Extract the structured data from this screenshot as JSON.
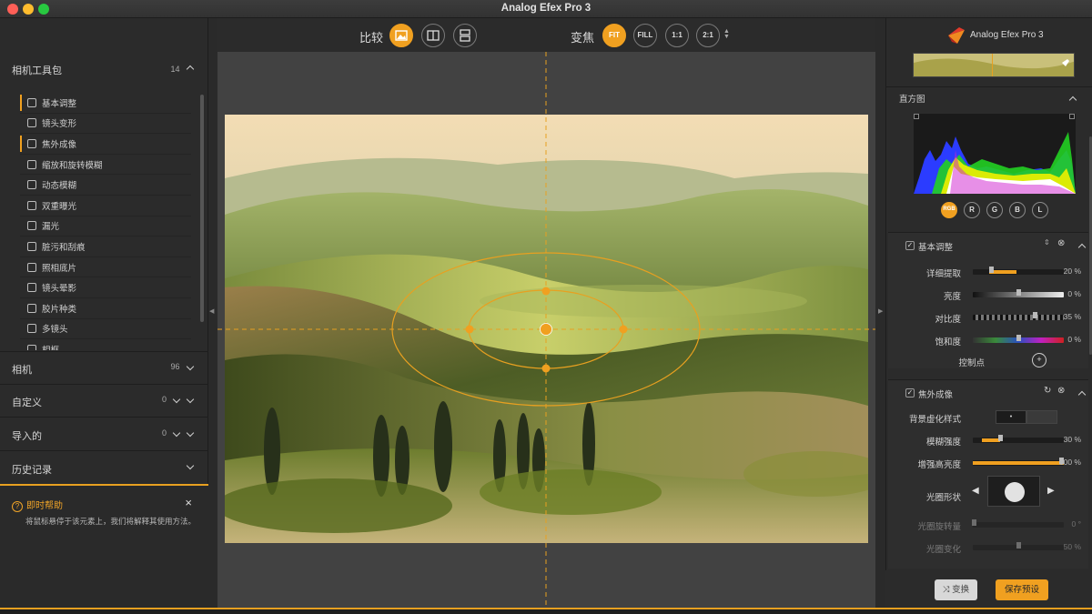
{
  "window": {
    "title": "Analog Efex Pro 3"
  },
  "left_panel": {
    "toolkit": {
      "title": "相机工具包",
      "count": "14"
    },
    "tools": [
      {
        "label": "基本调整",
        "active": true
      },
      {
        "label": "镜头变形",
        "active": false
      },
      {
        "label": "焦外成像",
        "active": true
      },
      {
        "label": "缩放和旋转模糊",
        "active": false
      },
      {
        "label": "动态模糊",
        "active": false
      },
      {
        "label": "双重曝光",
        "active": false
      },
      {
        "label": "漏光",
        "active": false
      },
      {
        "label": "脏污和刮痕",
        "active": false
      },
      {
        "label": "照相底片",
        "active": false
      },
      {
        "label": "镜头晕影",
        "active": false
      },
      {
        "label": "胶片种类",
        "active": false
      },
      {
        "label": "多镜头",
        "active": false
      },
      {
        "label": "相框",
        "active": false
      }
    ],
    "sections": [
      {
        "title": "相机",
        "count": "96"
      },
      {
        "title": "自定义",
        "count": "0"
      },
      {
        "title": "导入的",
        "count": "0"
      },
      {
        "title": "历史记录",
        "count": ""
      }
    ],
    "help": {
      "title": "即时帮助",
      "text": "将鼠标悬停于该元素上，我们将解释其使用方法。"
    }
  },
  "toolbar": {
    "compare_label": "比较",
    "zoom_label": "变焦",
    "zoom_options": [
      "FIT",
      "FILL",
      "1:1",
      "2:1"
    ],
    "zoom_selected": "FIT"
  },
  "right_panel": {
    "logo_text": "Analog Efex Pro 3",
    "histogram": {
      "title": "直方图",
      "channels": [
        "RGB",
        "R",
        "G",
        "B",
        "L"
      ],
      "selected": "RGB"
    },
    "basic": {
      "title": "基本调整",
      "rows": [
        {
          "label": "详细提取",
          "value": "20 %",
          "level": 0.2
        },
        {
          "label": "亮度",
          "value": "0 %",
          "level": 0.5
        },
        {
          "label": "对比度",
          "value": "35 %",
          "level": 0.68
        },
        {
          "label": "饱和度",
          "value": "0 %",
          "level": 0.5
        }
      ],
      "control_points": "控制点"
    },
    "bokeh": {
      "title": "焦外成像",
      "style_label": "背景虚化样式",
      "rows": [
        {
          "label": "模糊强度",
          "value": "30 %",
          "level": 0.3
        },
        {
          "label": "增强高亮度",
          "value": "100 %",
          "level": 1.0
        }
      ],
      "aperture_label": "光圈形状",
      "disabled_rows": [
        {
          "label": "光圈旋转量",
          "value": "0 °",
          "level": 0.0
        },
        {
          "label": "光圈变化",
          "value": "50 %",
          "level": 0.5
        }
      ]
    },
    "buttons": {
      "shuffle": "变换",
      "save": "保存预设"
    }
  },
  "colors": {
    "accent": "#f0a020",
    "panel": "#2b2b2b",
    "canvas": "#424242"
  }
}
